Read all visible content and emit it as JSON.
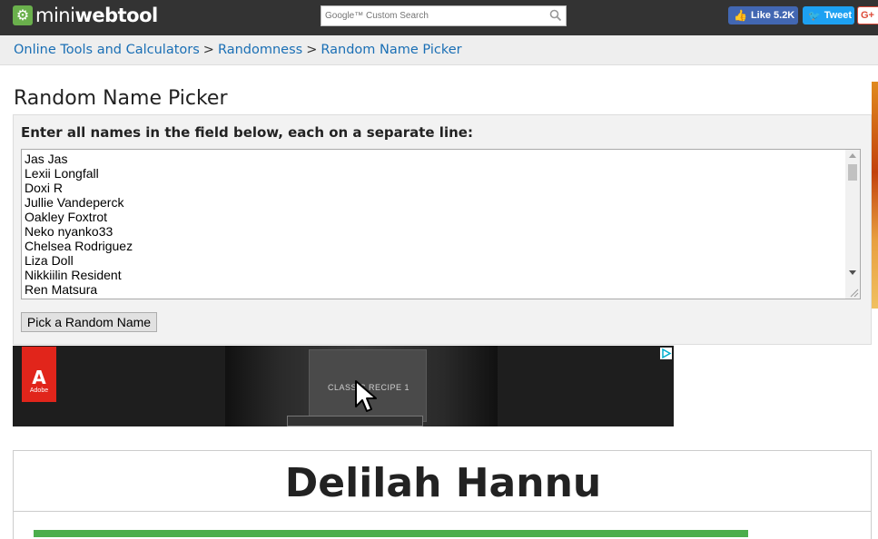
{
  "header": {
    "logo_light": "mini",
    "logo_bold": "webtool",
    "logo_icon": "gear-icon",
    "search_placeholder": "Google™ Custom Search",
    "facebook_label": "Like 5.2K",
    "twitter_label": "Tweet",
    "gplus_label": "G+"
  },
  "breadcrumb": {
    "items": [
      "Online Tools and Calculators",
      "Randomness",
      "Random Name Picker"
    ],
    "separator": ">"
  },
  "page": {
    "title": "Random Name Picker",
    "instruction": "Enter all names in the field below, each on a separate line:",
    "names": [
      "Jas Jas",
      "Lexii Longfall",
      "Doxi R",
      "Jullie Vandeperck",
      "Oakley Foxtrot",
      "Neko nyanko33",
      "Chelsea Rodriguez",
      "Liza Doll",
      "Nikkiilin Resident",
      "Ren Matsura"
    ],
    "pick_button": "Pick a Random Name"
  },
  "ad": {
    "brand_word": "Adobe",
    "card_text": "CLASSIC RECIPE 1"
  },
  "result": {
    "name": "Delilah Hannu"
  },
  "colors": {
    "topbar": "#333333",
    "link": "#1a6fb5",
    "facebook": "#4267b2",
    "twitter": "#1da1f2",
    "result_bar": "#4cae4c"
  }
}
